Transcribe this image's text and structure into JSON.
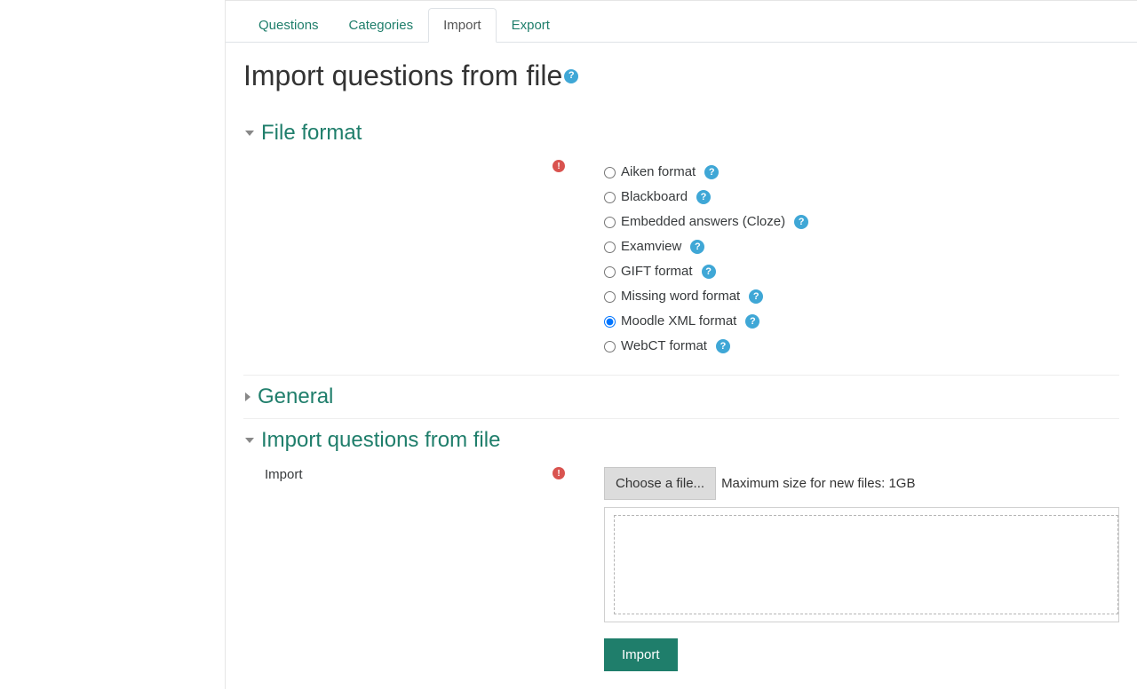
{
  "tabs": {
    "questions": "Questions",
    "categories": "Categories",
    "import": "Import",
    "export": "Export"
  },
  "page_title": "Import questions from file",
  "sections": {
    "file_format": {
      "title": "File format",
      "options": [
        {
          "label": "Aiken format",
          "selected": false
        },
        {
          "label": "Blackboard",
          "selected": false
        },
        {
          "label": "Embedded answers (Cloze)",
          "selected": false
        },
        {
          "label": "Examview",
          "selected": false
        },
        {
          "label": "GIFT format",
          "selected": false
        },
        {
          "label": "Missing word format",
          "selected": false
        },
        {
          "label": "Moodle XML format",
          "selected": true
        },
        {
          "label": "WebCT format",
          "selected": false
        }
      ]
    },
    "general": {
      "title": "General"
    },
    "import_file": {
      "title": "Import questions from file",
      "field_label": "Import",
      "choose_file": "Choose a file...",
      "max_size": "Maximum size for new files: 1GB"
    }
  },
  "submit_label": "Import"
}
